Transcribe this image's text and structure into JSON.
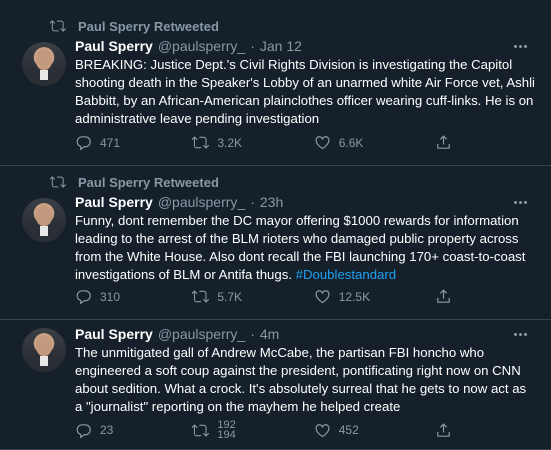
{
  "colors": {
    "background": "#15202b",
    "divider": "#38444d",
    "muted": "#8899a6",
    "text": "#ffffff",
    "link": "#1da1f2"
  },
  "tweets": [
    {
      "retweet_label": "Paul Sperry Retweeted",
      "name": "Paul Sperry",
      "handle": "@paulsperry_",
      "separator": "·",
      "time": "Jan 12",
      "text": "BREAKING: Justice Dept.'s Civil Rights Division is investigating the Capitol shooting death in the Speaker's Lobby of an unarmed white Air Force vet, Ashli Babbitt, by an African-American plainclothes officer wearing cuff-links. He is on administrative leave pending investigation",
      "hashtag": "",
      "replies": "471",
      "retweets": "3.2K",
      "likes": "6.6K"
    },
    {
      "retweet_label": "Paul Sperry Retweeted",
      "name": "Paul Sperry",
      "handle": "@paulsperry_",
      "separator": "·",
      "time": "23h",
      "text": "Funny, dont remember the DC mayor offering $1000 rewards for information leading to the arrest of the BLM rioters who damaged public property across from the White House. Also dont recall the FBI launching 170+ coast-to-coast investigations of BLM or Antifa thugs. ",
      "hashtag": "#Doublestandard",
      "replies": "310",
      "retweets": "5.7K",
      "likes": "12.5K"
    },
    {
      "name": "Paul Sperry",
      "handle": "@paulsperry_",
      "separator": "·",
      "time": "4m",
      "text": "The unmitigated gall of Andrew McCabe, the partisan FBI honcho who engineered a soft coup against the president, pontificating right now on CNN about sedition. What a crock. It's absolutely surreal that he gets to now act as a \"journalist\" reporting on the mayhem he helped create",
      "replies": "23",
      "retweets_old": "192",
      "retweets_new": "194",
      "likes": "452"
    }
  ]
}
